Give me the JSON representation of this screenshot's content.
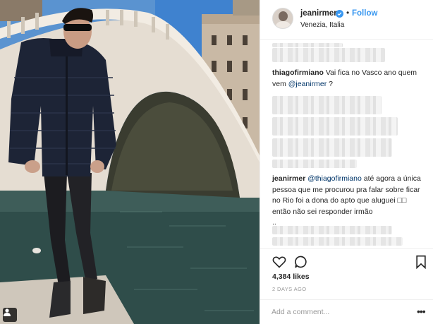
{
  "post": {
    "username": "jeanirmer",
    "verified": true,
    "follow_label": "Follow",
    "location": "Venezia, Italia",
    "comments": [
      {
        "user": "thiagofirmiano",
        "text": " Vai fica no Vasco ano quem vem ",
        "mention": "@jeanirmer",
        "suffix": " ?"
      },
      {
        "user": "jeanirmer",
        "mention": "@thiagofirmiano",
        "text": " até agora a única pessoa que me procurou pra falar sobre ficar no Rio foi a dona do apto que aluguei □□ então não sei responder irmão",
        "trailing": ".."
      }
    ],
    "likes": "4,384 likes",
    "time": "2 DAYS AGO",
    "add_comment_placeholder": "Add a comment...",
    "options_label": "•••"
  },
  "icons": {
    "like": "heart-icon",
    "comment": "comment-icon",
    "save": "bookmark-icon",
    "verified": "verified-badge-icon",
    "user_tag": "user-tag-icon"
  },
  "colors": {
    "link": "#3897f0",
    "text": "#262626",
    "muted": "#999999",
    "border": "#efefef"
  }
}
